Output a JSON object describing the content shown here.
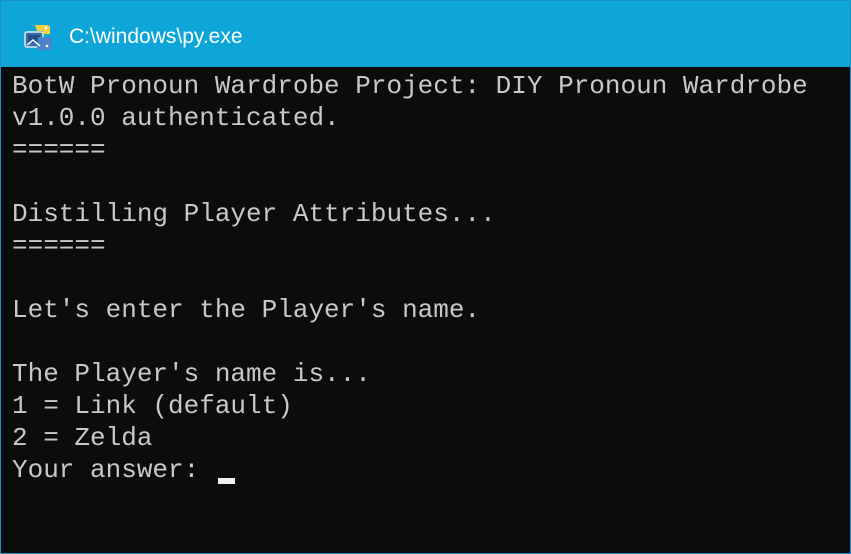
{
  "window": {
    "title": "C:\\windows\\py.exe",
    "icon": "python-launcher-icon"
  },
  "console": {
    "lines": [
      "BotW Pronoun Wardrobe Project: DIY Pronoun Wardrobe",
      "v1.0.0 authenticated.",
      "======",
      "Distilling Player Attributes...",
      "======",
      "Let's enter the Player's name.",
      "The Player's name is...",
      "1 = Link (default)",
      "2 = Zelda",
      "Your answer: "
    ]
  },
  "colors": {
    "titlebar": "#0ea5d8",
    "console_bg": "#0c0c0c",
    "console_text": "#c8c8c8"
  }
}
